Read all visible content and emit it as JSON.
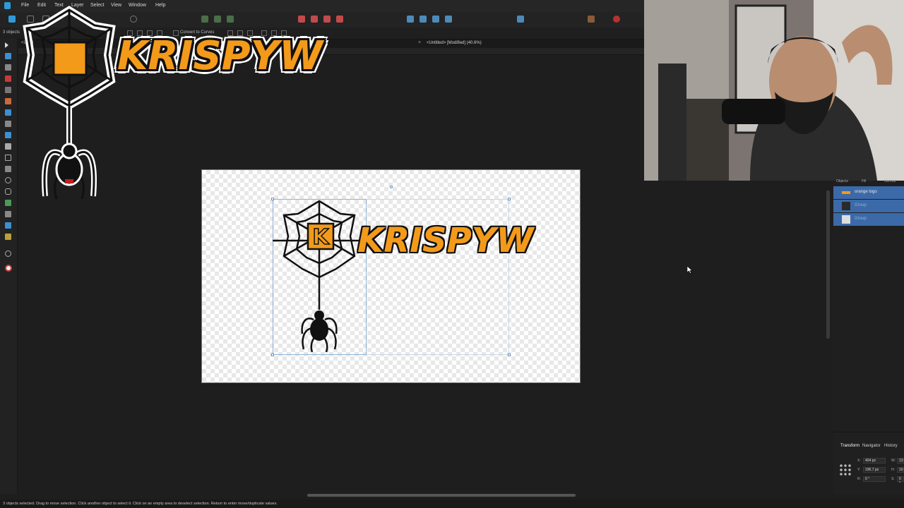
{
  "menu": {
    "items": [
      "File",
      "Edit",
      "Text",
      "Layer",
      "Select",
      "View",
      "Window",
      "Help"
    ]
  },
  "context_bar": {
    "selection_count": "3 objects",
    "convert_label": "Convert to Curves"
  },
  "document": {
    "tab_title": "<Untitled> [Modified] (40.6%)",
    "close_glyph": "×",
    "left_tab_title": "<Untitl"
  },
  "overlay": {
    "brand_text": "KRISPYW"
  },
  "canvas": {
    "logo_text": "KRISPYW"
  },
  "layers": {
    "header_tabs": [
      "Objects",
      "Fill",
      "Normal"
    ],
    "rows": [
      {
        "label": "orange logo"
      },
      {
        "label": "Group"
      },
      {
        "label": "Group"
      }
    ]
  },
  "transform_panel": {
    "tabs": [
      "Transform",
      "Navigator",
      "History"
    ],
    "x_label": "X:",
    "x_value": "404 px",
    "y_label": "Y:",
    "y_value": "196.7 px",
    "r_label": "R:",
    "r_value": "0 °",
    "w_label": "W:",
    "w_value": "13",
    "h_label": "H:",
    "h_value": "10",
    "s_label": "S:",
    "s_value": "0 °"
  },
  "status": {
    "text": "3 objects selected. Drag to move selection. Click another object to select it. Click on an empty area to deselect selection. Return to enter move/duplicate values."
  },
  "colors": {
    "accent_blue": "#3c6aa8",
    "logo_orange": "#f39a1a",
    "app_bg": "#1e1e1e"
  },
  "icons": [
    "affinity-app-icon",
    "move-tool-icon",
    "pen-tool-icon",
    "close-icon",
    "cursor-icon",
    "spider-web-icon",
    "spider-icon"
  ]
}
